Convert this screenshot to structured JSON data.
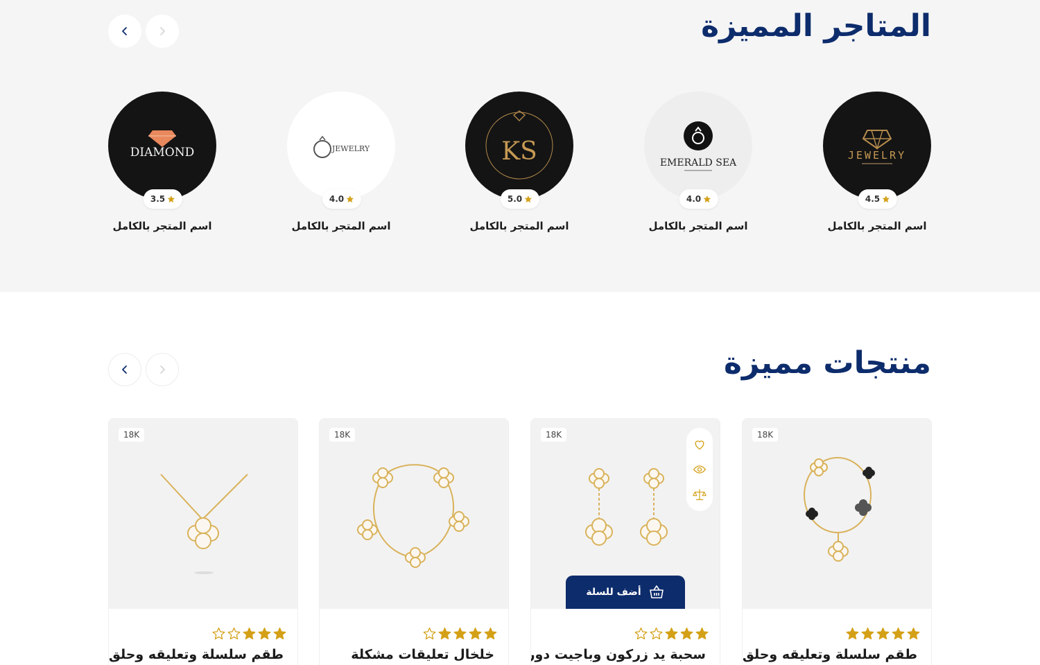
{
  "colors": {
    "brand": "#0d2c6c",
    "gold": "#d4a017",
    "section_bg": "#f5f5f5"
  },
  "stores_section": {
    "title": "المتاجر المميزة",
    "stores": [
      {
        "name": "اسم المتجر بالكامل",
        "rating": "4.5",
        "logo_text": "JEWELRY"
      },
      {
        "name": "اسم المتجر بالكامل",
        "rating": "4.0",
        "logo_text": "EMERALD SEA"
      },
      {
        "name": "اسم المتجر بالكامل",
        "rating": "5.0",
        "logo_text": "KS"
      },
      {
        "name": "اسم المتجر بالكامل",
        "rating": "4.0",
        "logo_text": "JEWELRY"
      },
      {
        "name": "اسم المتجر بالكامل",
        "rating": "3.5",
        "logo_text": "DIAMOND"
      }
    ]
  },
  "products_section": {
    "title": "منتجات مميزة",
    "add_to_cart_label": "أضف للسلة",
    "products": [
      {
        "name": "طقم سلسلة وتعليقه وحلق",
        "karat": "18K",
        "rating_out_of_5": 5
      },
      {
        "name": "سحبة يد زركون وباجيت دورين",
        "karat": "18K",
        "rating_out_of_5": 3
      },
      {
        "name": "خلخال تعليقات مشكلة",
        "karat": "18K",
        "rating_out_of_5": 4
      },
      {
        "name": "طقم سلسلة وتعليقه وحلق",
        "karat": "18K",
        "rating_out_of_5": 3
      }
    ]
  },
  "icons": {
    "prev": "chevron-left-icon",
    "next": "chevron-right-icon",
    "rating": "star-icon",
    "wishlist": "heart-icon",
    "quick_view": "eye-icon",
    "compare": "scale-icon",
    "cart": "basket-icon"
  }
}
